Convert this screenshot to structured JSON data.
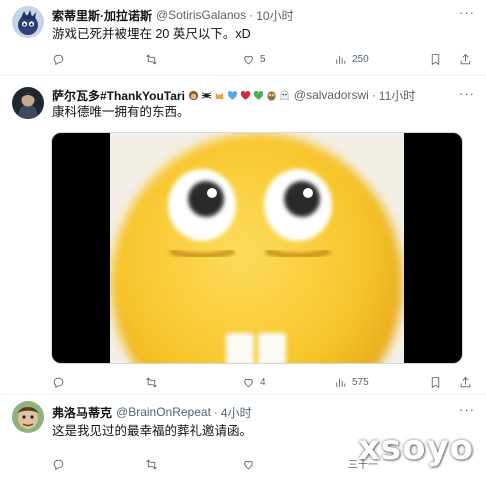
{
  "tweets": [
    {
      "name": "索蒂里斯·加拉诺斯",
      "handle": "@SotirisGalanos",
      "time": "10小时",
      "text": "游戏已死并被埋在 20 英尺以下。xD",
      "replies": "",
      "retweets": "",
      "likes": "5",
      "views": "250"
    },
    {
      "name": "萨尔瓦多#ThankYouTari",
      "handle": "@salvadorswi",
      "time": "11小时",
      "text": "康科德唯一拥有的东西。",
      "replies": "",
      "retweets": "",
      "likes": "4",
      "views": "575"
    },
    {
      "name": "弗洛马蒂克",
      "handle": "@BrainOnRepeat",
      "time": "4小时",
      "text": "这是我见过的最幸福的葬礼邀请函。",
      "replies": "",
      "retweets": "",
      "likes": "",
      "views": ""
    }
  ],
  "separator": "·",
  "more_glyph": "···",
  "watermark": "xsoyo",
  "watermark_tail": "三十一",
  "colors": {
    "text_primary": "#0f1419",
    "text_secondary": "#536471",
    "divider": "#eff3f4",
    "emoji_yellow": "#f7c52a"
  }
}
